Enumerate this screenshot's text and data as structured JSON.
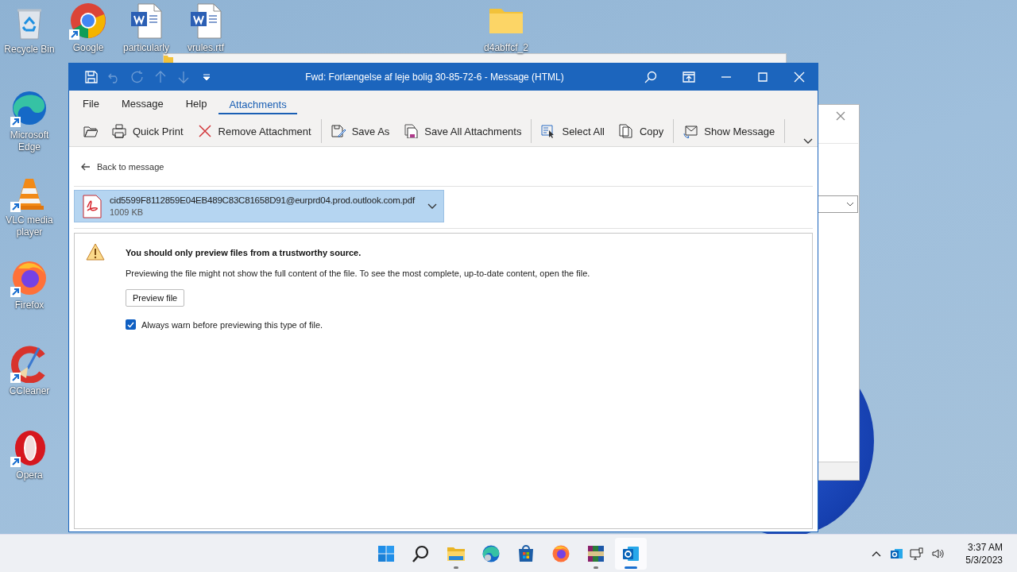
{
  "desktop": {
    "icons": [
      {
        "label": "Recycle Bin",
        "kind": "recycle"
      },
      {
        "label": "Google",
        "kind": "chrome"
      },
      {
        "label": "particularly",
        "kind": "word"
      },
      {
        "label": "vrules.rtf",
        "kind": "word"
      },
      {
        "label": "d4abffcf_2",
        "kind": "folder"
      },
      {
        "label": "Microsoft Edge",
        "kind": "edge"
      },
      {
        "label": "VLC media player",
        "kind": "vlc"
      },
      {
        "label": "Firefox",
        "kind": "firefox"
      },
      {
        "label": "CCleaner",
        "kind": "ccleaner"
      },
      {
        "label": "Opera",
        "kind": "opera"
      }
    ]
  },
  "window": {
    "title": "Fwd: Forlængelse af leje bolig 30-85-72-6 - Message (HTML)",
    "quick_access": [
      {
        "kind": "save",
        "disabled": false
      },
      {
        "kind": "undo",
        "disabled": true
      },
      {
        "kind": "redo",
        "disabled": true
      },
      {
        "kind": "up",
        "disabled": true
      },
      {
        "kind": "down",
        "disabled": true
      },
      {
        "kind": "customize",
        "disabled": false
      }
    ],
    "menu_tabs": [
      {
        "label": "File",
        "selected": false
      },
      {
        "label": "Message",
        "selected": false
      },
      {
        "label": "Help",
        "selected": false
      },
      {
        "label": "Attachments",
        "selected": true
      }
    ],
    "ribbon": [
      {
        "kind": "open"
      },
      {
        "kind": "print",
        "label": "Quick Print"
      },
      {
        "kind": "remove",
        "label": "Remove Attachment"
      },
      {
        "kind": "separator"
      },
      {
        "kind": "saveas",
        "label": "Save As"
      },
      {
        "kind": "saveall",
        "label": "Save All Attachments"
      },
      {
        "kind": "separator"
      },
      {
        "kind": "selectall",
        "label": "Select All"
      },
      {
        "kind": "copy",
        "label": "Copy"
      },
      {
        "kind": "separator"
      },
      {
        "kind": "showmessage",
        "label": "Show Message"
      },
      {
        "kind": "separator"
      }
    ],
    "back_link": "Back to message",
    "attachment": {
      "name": "cid5599F8112859E04EB489C83C81658D91@eurprd04.prod.outlook.com.pdf",
      "size": "1009 KB",
      "selected": true
    },
    "warning": {
      "heading": "You should only preview files from a trustworthy source.",
      "body": "Previewing the file might not show the full content of the file. To see the most complete, up-to-date content, open the file.",
      "button": "Preview file",
      "checkbox": {
        "label": "Always warn before previewing this type of file.",
        "checked": true
      }
    }
  },
  "taskbar": {
    "apps": [
      {
        "kind": "start",
        "running": false,
        "active": false
      },
      {
        "kind": "search",
        "running": false,
        "active": false
      },
      {
        "kind": "explorer",
        "running": true,
        "active": false
      },
      {
        "kind": "edge",
        "running": false,
        "active": false
      },
      {
        "kind": "store",
        "running": false,
        "active": false
      },
      {
        "kind": "firefox",
        "running": false,
        "active": false
      },
      {
        "kind": "winrar",
        "running": true,
        "active": false
      },
      {
        "kind": "outlook",
        "running": true,
        "active": true
      }
    ],
    "tray": [
      {
        "kind": "chevron"
      },
      {
        "kind": "outlook"
      },
      {
        "kind": "network"
      },
      {
        "kind": "volume"
      }
    ],
    "time": "3:37 AM",
    "date": "5/3/2023"
  }
}
